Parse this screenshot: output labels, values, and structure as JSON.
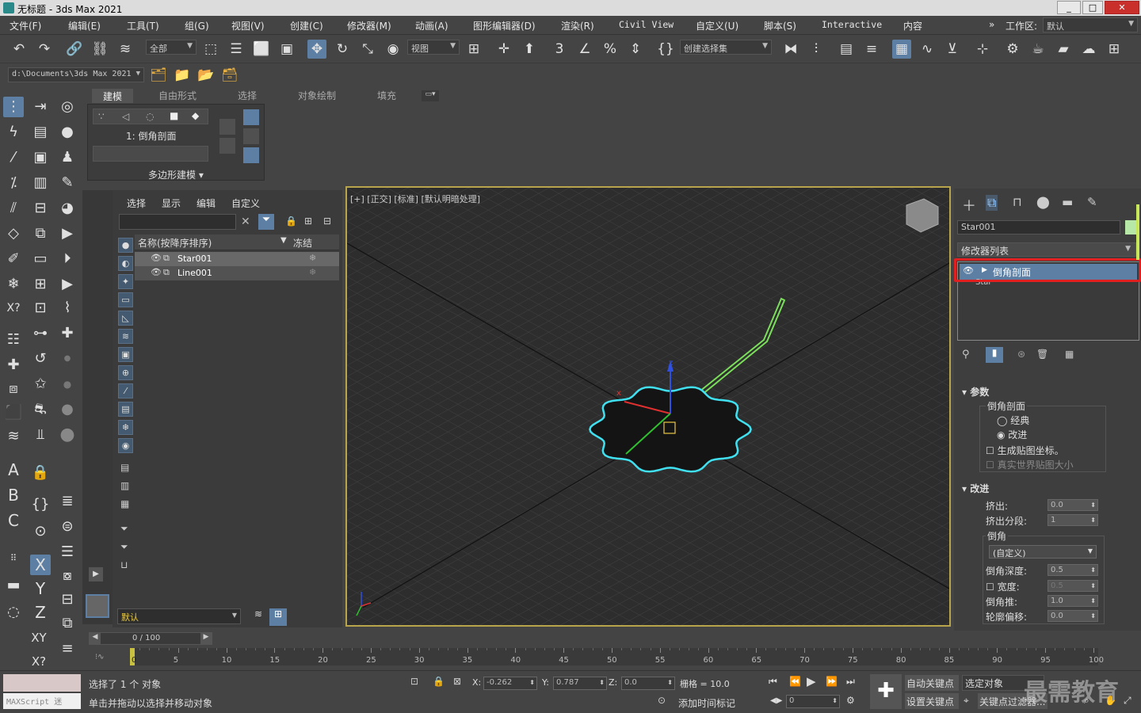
{
  "window": {
    "title": "无标题 - 3ds Max 2021",
    "min": "_",
    "max": "□",
    "close": "✕"
  },
  "menu": [
    "文件(F)",
    "编辑(E)",
    "工具(T)",
    "组(G)",
    "视图(V)",
    "创建(C)",
    "修改器(M)",
    "动画(A)",
    "图形编辑器(D)",
    "渲染(R)",
    "Civil View",
    "自定义(U)",
    "脚本(S)",
    "Interactive",
    "内容"
  ],
  "workspace": {
    "label": "工作区:",
    "value": "默认",
    "more": "»"
  },
  "toolbar": {
    "filter_value": "全部",
    "ref_coord": "视图",
    "named_selection": "创建选择集",
    "angle_snap": "3"
  },
  "pathbar": {
    "path": "d:\\Documents\\3ds Max 2021"
  },
  "ribbon": {
    "tabs": [
      "建模",
      "自由形式",
      "选择",
      "对象绘制",
      "填充"
    ],
    "modifier_label": "1: 倒角剖面",
    "panel_title": "多边形建模 ▾"
  },
  "scene_explorer": {
    "menus": [
      "选择",
      "显示",
      "编辑",
      "自定义"
    ],
    "col_name": "名称(按降序排序)",
    "col_freeze": "冻结",
    "items": [
      "Star001",
      "Line001"
    ],
    "layer": "默认"
  },
  "viewport": {
    "label": "[+] [正交] [标准] [默认明暗处理]"
  },
  "command_panel": {
    "object_name": "Star001",
    "modifier_list": "修改器列表",
    "stack": [
      "倒角剖面",
      "Star"
    ],
    "params_title": "参数",
    "group_bevel": "倒角剖面",
    "radio_classic": "经典",
    "radio_improved": "改进",
    "chk_mapcoords": "生成贴图坐标。",
    "chk_realworld": "真实世界贴图大小",
    "improved_title": "改进",
    "extrude_label": "挤出:",
    "extrude_val": "0.0",
    "extrude_seg_label": "挤出分段:",
    "extrude_seg_val": "1",
    "bevel_group": "倒角",
    "bevel_type": "(自定义)",
    "bevel_depth_label": "倒角深度:",
    "bevel_depth_val": "0.5",
    "width_label": "宽度:",
    "width_val": "0.5",
    "bevel_push_label": "倒角推:",
    "bevel_push_val": "1.0",
    "outline_label": "轮廓偏移:",
    "outline_val": "0.0"
  },
  "timeline": {
    "frame": "0 / 100",
    "ticks": [
      "5",
      "10",
      "15",
      "20",
      "25",
      "30",
      "35",
      "40",
      "45",
      "50",
      "55",
      "60",
      "65",
      "70",
      "75",
      "80",
      "85",
      "90",
      "95",
      "100"
    ],
    "zero": "0"
  },
  "status": {
    "maxscript": "MAXScript 迷",
    "selected": "选择了 1 个 对象",
    "hint": "单击并拖动以选择并移动对象",
    "x_label": "X:",
    "x_val": "-0.262",
    "y_label": "Y:",
    "y_val": "0.787",
    "z_label": "Z:",
    "z_val": "0.0",
    "grid": "栅格 = 10.0",
    "add_time_tag": "添加时间标记",
    "auto_key": "自动关键点",
    "selected_obj": "选定对象",
    "set_key": "设置关键点",
    "key_filters": "关键点过滤器...",
    "frame_val": "0",
    "watermark": "最需教育"
  },
  "colors": {
    "accent": "#5c7fa3",
    "highlight_red": "#e02020",
    "spline_cyan": "#40e0f0",
    "line_green": "#7adf5a",
    "viewport_border": "#b8a44a"
  }
}
